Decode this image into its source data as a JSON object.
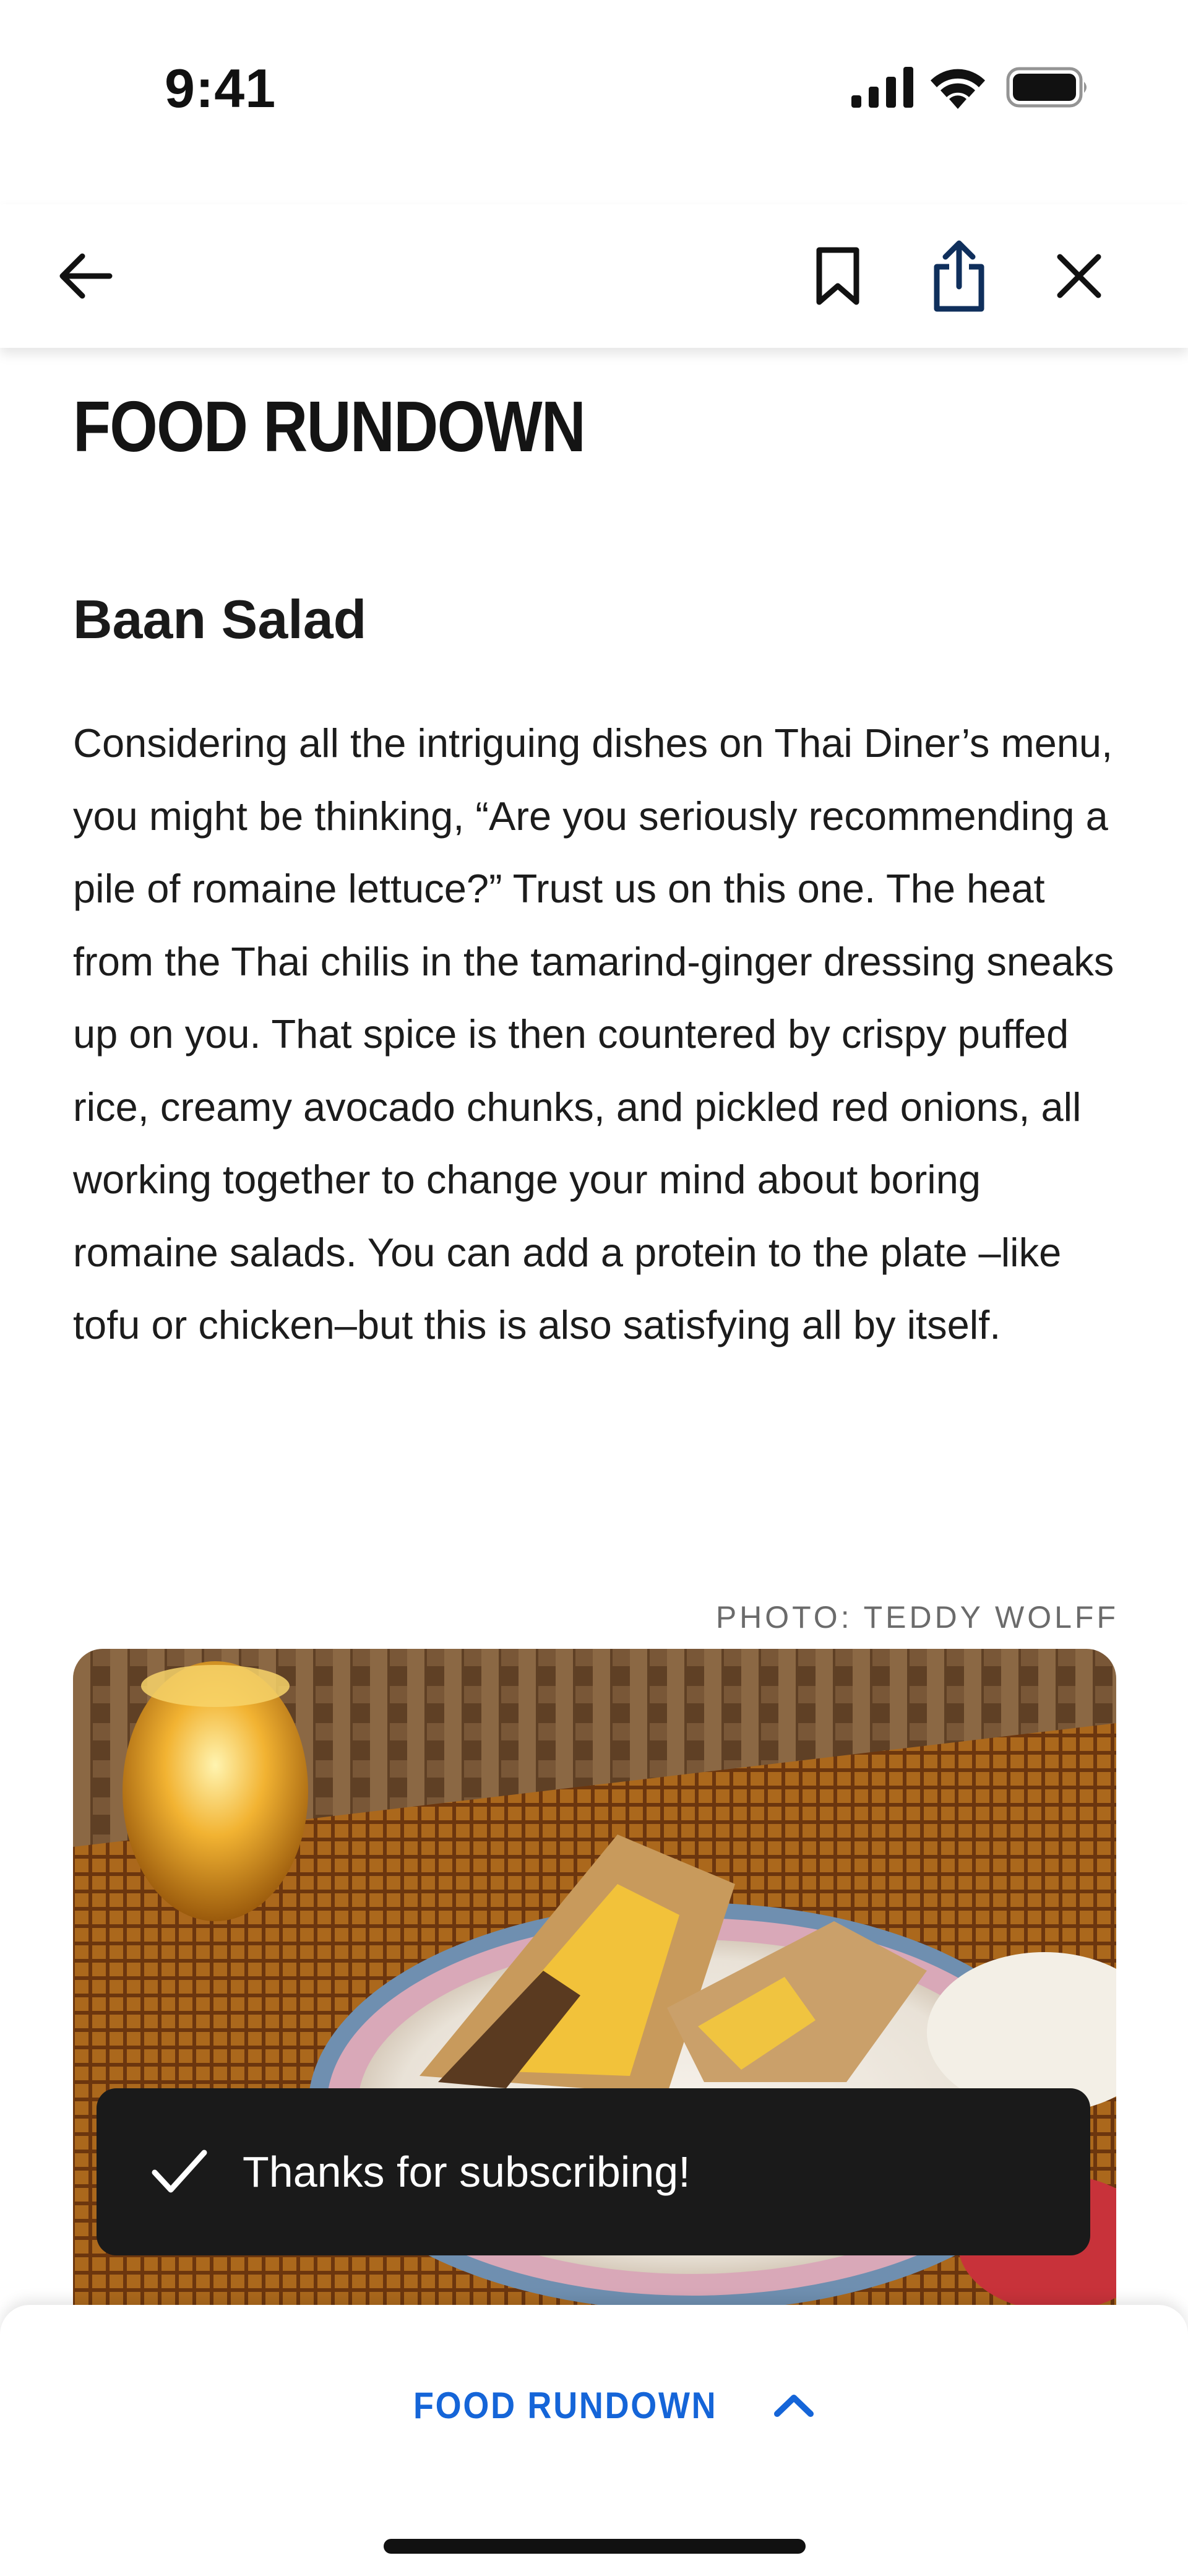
{
  "status_bar": {
    "time": "9:41",
    "icons": [
      "cellular-signal-icon",
      "wifi-icon",
      "battery-icon"
    ]
  },
  "nav": {
    "icons": [
      "back-arrow-icon",
      "bookmark-icon",
      "share-icon",
      "close-icon"
    ]
  },
  "article": {
    "section_title": "FOOD RUNDOWN",
    "dish_title": "Baan Salad",
    "body": "Considering all the intriguing dishes on Thai Diner’s menu, you might be thinking, “Are you seriously recommending a pile of romaine lettuce?” Trust us on this one. The heat from the Thai chilis in the tamarind-ginger dressing sneaks up on you. That spice is then countered by crispy puffed rice, creamy avocado chunks, and pickled red onions, all working together to change your mind about boring romaine salads. You can add a protein to the plate –like tofu or chicken–but this is also satisfying all by itself.",
    "photo_credit": "PHOTO: TEDDY WOLFF"
  },
  "toast": {
    "message": "Thanks for subscribing!",
    "icon": "checkmark-icon"
  },
  "bottom_sheet": {
    "label": "FOOD RUNDOWN",
    "icon": "chevron-up-icon"
  },
  "colors": {
    "accent": "#1565d8",
    "toast_bg": "#1a1a1a",
    "text": "#1a1a1a",
    "muted": "#6b6b6b"
  }
}
